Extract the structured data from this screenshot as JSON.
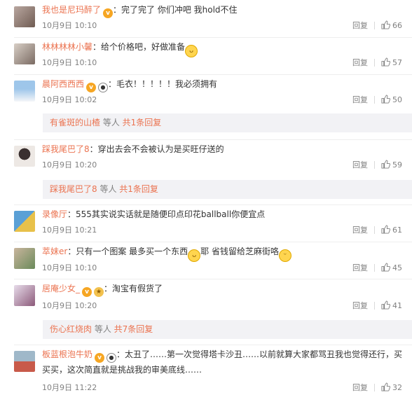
{
  "comments": [
    {
      "user": "我也是尼玛醉了",
      "badges": [
        "vip"
      ],
      "text": "：完了完了 你们冲吧 我hold不住",
      "emoji_after": "",
      "time": "10月9日 10:10",
      "reply_label": "回复",
      "likes": "66",
      "avatar_colors": [
        "#b9a7a0",
        "#6f5b52"
      ]
    },
    {
      "user": "林林林林小馨",
      "badges": [],
      "text": "：给个价格吧，好做准备",
      "emoji_after": "laughing-emoji",
      "time": "10月9日 10:10",
      "reply_label": "回复",
      "likes": "57",
      "avatar_colors": [
        "#d8cfc6",
        "#7a6a62"
      ]
    },
    {
      "user": "晨阿西西西",
      "badges": [
        "vip",
        "panda"
      ],
      "text": "：毛衣！！！！！我必须拥有",
      "emoji_after": "",
      "time": "10月9日 10:02",
      "reply_label": "回复",
      "likes": "50",
      "avatar_colors": [
        "#9ec6ea",
        "#f4f6f8"
      ],
      "sub_reply": {
        "user": "有雀斑的山楂",
        "suffix": " 等人 ",
        "count": "共1条回复"
      }
    },
    {
      "user": "踩我尾巴了8",
      "badges": [],
      "text": "：穿出去会不会被认为是买旺仔送的",
      "emoji_after": "",
      "time": "10月9日 10:20",
      "reply_label": "回复",
      "likes": "59",
      "avatar_colors": [
        "#ede8e4",
        "#3a3030"
      ],
      "sub_reply": {
        "user": "踩我尾巴了8",
        "suffix": " 等人 ",
        "count": "共1条回复"
      }
    },
    {
      "user": "录像厅",
      "badges": [],
      "text": "：555其实说实话就是随便印点印花ballball你便宜点",
      "emoji_after": "",
      "time": "10月9日 10:21",
      "reply_label": "回复",
      "likes": "61",
      "avatar_colors": [
        "#5aa0d6",
        "#e8c14a"
      ]
    },
    {
      "user": "萃妹er",
      "badges": [],
      "text": "：只有一个图案 最多买一个东西",
      "emoji_after": "laughing-emoji",
      "text2": "耶 省钱留给芝麻街咯",
      "emoji_after2": "grin-emoji",
      "time": "10月9日 10:10",
      "reply_label": "回复",
      "likes": "45",
      "avatar_colors": [
        "#c9b59d",
        "#6a8a5a"
      ]
    },
    {
      "user": "居庵少女_",
      "badges": [
        "vip",
        "gold"
      ],
      "text": "：淘宝有假货了",
      "emoji_after": "",
      "time": "10月9日 10:20",
      "reply_label": "回复",
      "likes": "41",
      "avatar_colors": [
        "#e7dcea",
        "#8c5a7a"
      ],
      "sub_reply": {
        "user": "伤心红烧肉",
        "suffix": " 等人 ",
        "count": "共7条回复"
      }
    },
    {
      "user": "板蓝根泡牛奶",
      "badges": [
        "vip",
        "panda"
      ],
      "text": "：太丑了……第一次觉得塔卡沙丑……以前就算大家都骂丑我也觉得还行，买",
      "text_line2": "买买，这次简直就是挑战我的审美底线……",
      "emoji_after": "",
      "time": "10月9日 11:22",
      "reply_label": "回复",
      "likes": "32",
      "avatar_colors": [
        "#9fb8c9",
        "#c85a4a"
      ]
    }
  ],
  "accent_color": "#eb7350",
  "muted_color": "#808080"
}
